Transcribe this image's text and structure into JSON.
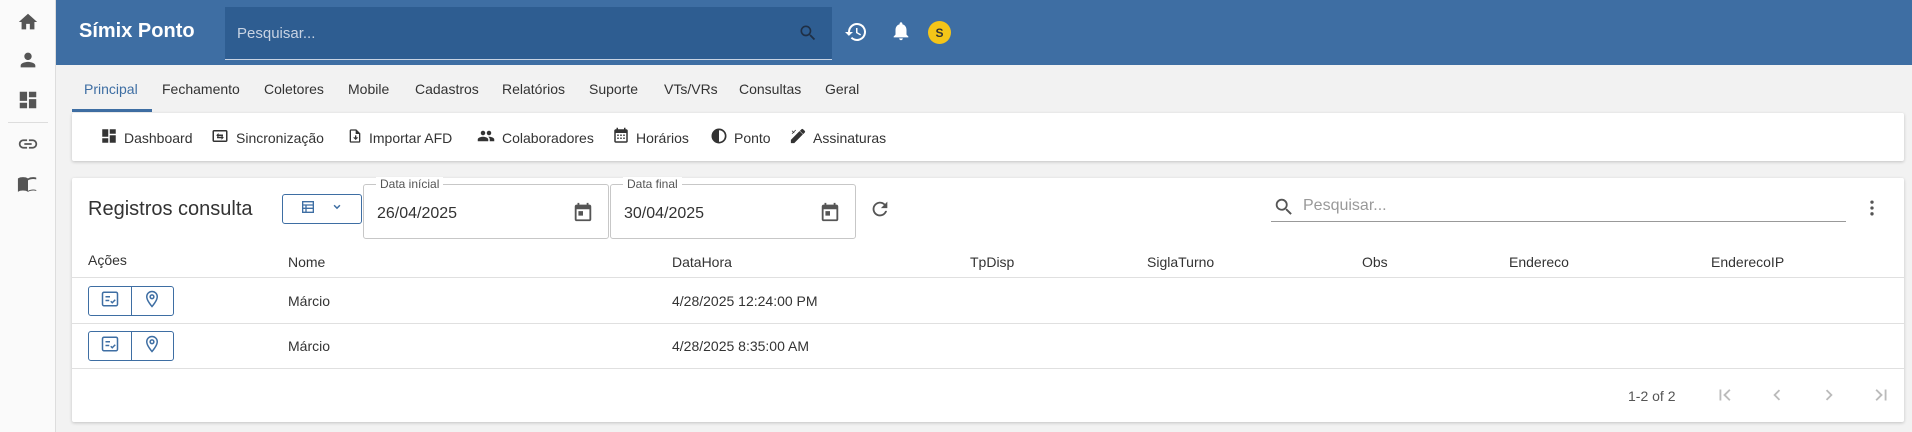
{
  "rail": {
    "items": [
      "home-icon",
      "person-icon",
      "dashboard-icon",
      "link-icon",
      "book-icon"
    ]
  },
  "header": {
    "title": "Símix Ponto",
    "search_placeholder": "Pesquisar...",
    "avatar_initial": "S"
  },
  "tabs": [
    "Principal",
    "Fechamento",
    "Coletores",
    "Mobile",
    "Cadastros",
    "Relatórios",
    "Suporte",
    "VTs/VRs",
    "Consultas",
    "Geral"
  ],
  "subnav": [
    "Dashboard",
    "Sincronização",
    "Importar AFD",
    "Colaboradores",
    "Horários",
    "Ponto",
    "Assinaturas"
  ],
  "card": {
    "title": "Registros consulta",
    "start_label": "Data inícial",
    "start_value": "26/04/2025",
    "end_label": "Data final",
    "end_value": "30/04/2025",
    "search_placeholder": "Pesquisar..."
  },
  "table": {
    "columns": [
      "Ações",
      "Nome",
      "DataHora",
      "TpDisp",
      "SiglaTurno",
      "Obs",
      "Endereco",
      "EnderecoIP"
    ],
    "rows": [
      {
        "nome": "Márcio",
        "datahora": "4/28/2025 12:24:00 PM"
      },
      {
        "nome": "Márcio",
        "datahora": "4/28/2025 8:35:00 AM"
      }
    ]
  },
  "pagination": {
    "range": "1-2 of 2"
  },
  "colors": {
    "primary": "#3e6ea3",
    "header_search_bg": "#2e5d91",
    "avatar": "#f5c518"
  }
}
